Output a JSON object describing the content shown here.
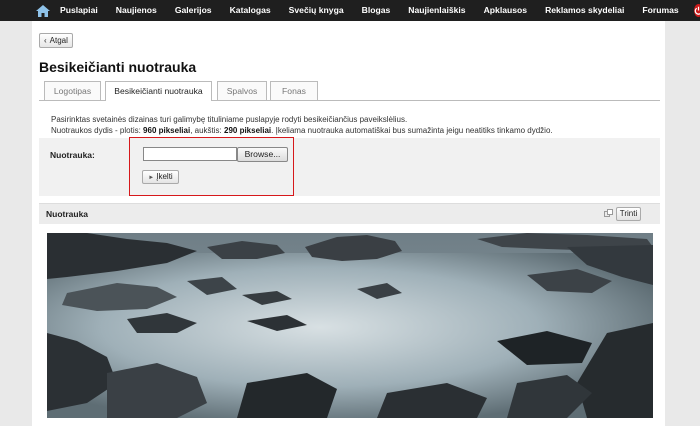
{
  "nav": {
    "items": [
      "Puslapiai",
      "Naujienos",
      "Galerijos",
      "Katalogas",
      "Svečių knyga",
      "Blogas",
      "Naujienlaiškis",
      "Apklausos",
      "Reklamos skydeliai",
      "Forumas"
    ]
  },
  "back_label": "Atgal",
  "page_title": "Besikeičianti nuotrauka",
  "tabs": [
    "Logotipas",
    "Besikeičianti nuotrauka",
    "Spalvos",
    "Fonas"
  ],
  "info": {
    "line1": "Pasirinktas svetainės dizainas turi galimybę tituliniame puslapyje rodyti besikeičiančius paveikslėlius.",
    "line2_prefix": "Nuotraukos dydis - plotis: ",
    "width_value": "960 pikseliai",
    "line2_mid": ", aukštis: ",
    "height_value": "290 pikseliai",
    "line2_suffix": ". Įkeliama nuotrauka automatiškai bus sumažinta jeigu neatitiks tinkamo dydžio."
  },
  "form": {
    "label": "Nuotrauka:",
    "browse_label": "Browse...",
    "upload_label": "Įkelti"
  },
  "section": {
    "title": "Nuotrauka",
    "delete_label": "Trinti"
  }
}
